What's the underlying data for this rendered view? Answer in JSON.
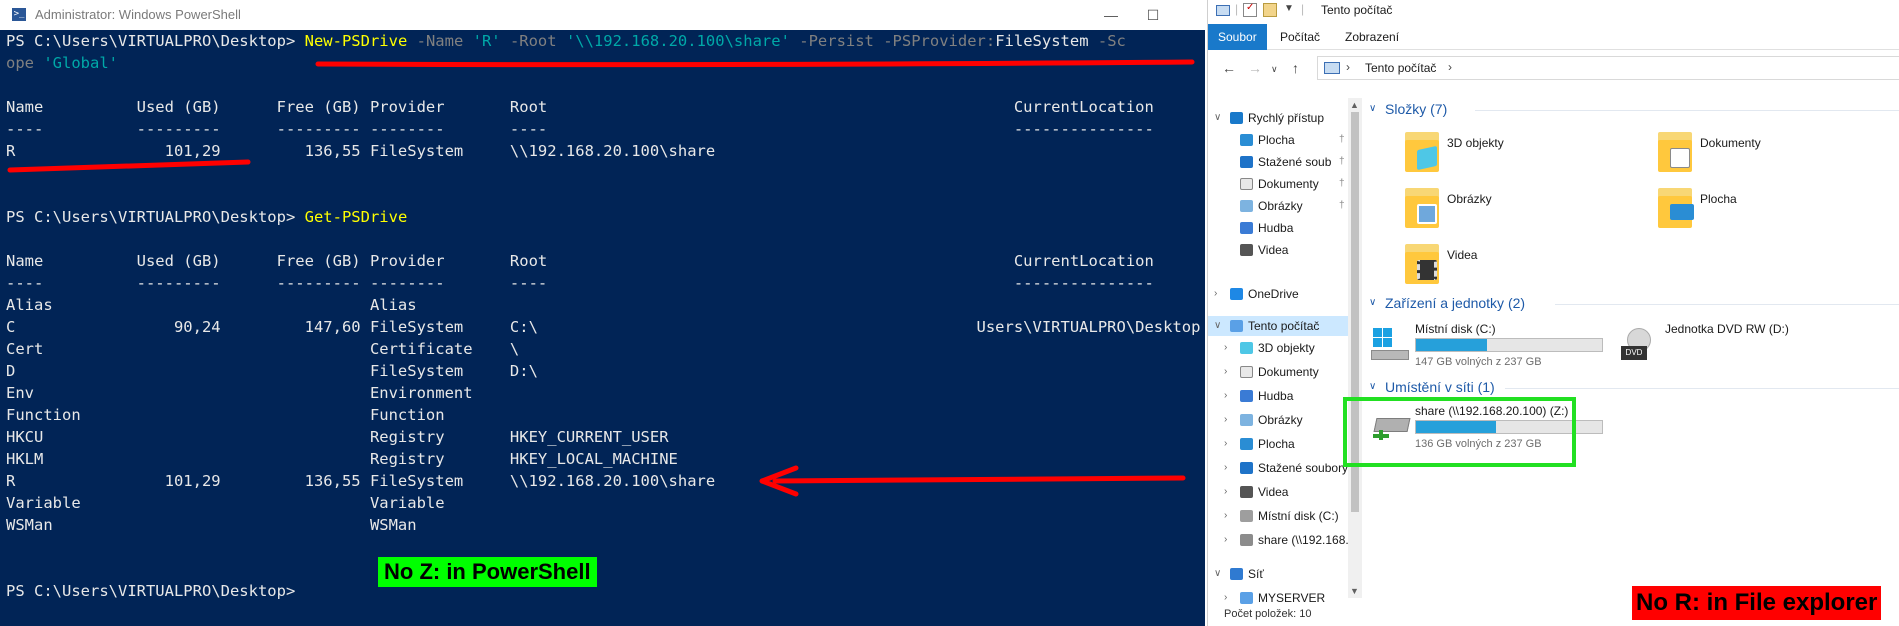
{
  "powershell": {
    "window_title": "Administrator: Windows PowerShell",
    "prompt": "PS C:\\Users\\VIRTUALPRO\\Desktop>",
    "command1": {
      "cmdlet": "New-PSDrive",
      "p_name": "-Name",
      "v_name": "'R'",
      "p_root": "-Root",
      "v_root": "'\\\\192.168.20.100\\share'",
      "p_persist": "-Persist",
      "p_provider": "-PSProvider:",
      "v_provider": "FileSystem",
      "p_scope_a": "-Sc",
      "p_scope_b": "ope",
      "v_scope": "'Global'"
    },
    "headers": {
      "name": "Name",
      "used": "Used (GB)",
      "free": "Free (GB)",
      "provider": "Provider",
      "root": "Root",
      "location": "CurrentLocation"
    },
    "dashes": {
      "name": "----",
      "used": "---------",
      "free": "---------",
      "provider": "--------",
      "root": "----",
      "location": "---------------"
    },
    "new_drive_row": {
      "name": "R",
      "used": "101,29",
      "free": "136,55",
      "provider": "FileSystem",
      "root": "\\\\192.168.20.100\\share",
      "location": ""
    },
    "command2": "Get-PSDrive",
    "drives": [
      {
        "name": "Alias",
        "used": "",
        "free": "",
        "provider": "Alias",
        "root": "",
        "location": ""
      },
      {
        "name": "C",
        "used": "90,24",
        "free": "147,60",
        "provider": "FileSystem",
        "root": "C:\\",
        "location": "Users\\VIRTUALPRO\\Desktop"
      },
      {
        "name": "Cert",
        "used": "",
        "free": "",
        "provider": "Certificate",
        "root": "\\",
        "location": ""
      },
      {
        "name": "D",
        "used": "",
        "free": "",
        "provider": "FileSystem",
        "root": "D:\\",
        "location": ""
      },
      {
        "name": "Env",
        "used": "",
        "free": "",
        "provider": "Environment",
        "root": "",
        "location": ""
      },
      {
        "name": "Function",
        "used": "",
        "free": "",
        "provider": "Function",
        "root": "",
        "location": ""
      },
      {
        "name": "HKCU",
        "used": "",
        "free": "",
        "provider": "Registry",
        "root": "HKEY_CURRENT_USER",
        "location": ""
      },
      {
        "name": "HKLM",
        "used": "",
        "free": "",
        "provider": "Registry",
        "root": "HKEY_LOCAL_MACHINE",
        "location": ""
      },
      {
        "name": "R",
        "used": "101,29",
        "free": "136,55",
        "provider": "FileSystem",
        "root": "\\\\192.168.20.100\\share",
        "location": ""
      },
      {
        "name": "Variable",
        "used": "",
        "free": "",
        "provider": "Variable",
        "root": "",
        "location": ""
      },
      {
        "name": "WSMan",
        "used": "",
        "free": "",
        "provider": "WSMan",
        "root": "",
        "location": ""
      }
    ],
    "annotation": "No Z: in PowerShell",
    "colors": {
      "background": "#012456",
      "command": "#ffff00",
      "string": "#00a8a8",
      "parameter": "#808080",
      "annotation": "#00ff00",
      "marker": "#ff0000"
    }
  },
  "explorer": {
    "window_title": "Tento počítač",
    "ribbon_tabs": [
      "Soubor",
      "Počítač",
      "Zobrazení"
    ],
    "address_crumb": "Tento počítač",
    "nav_items": [
      {
        "label": "Rychlý přístup",
        "icon": "star-icon"
      },
      {
        "label": "Plocha",
        "icon": "desktop-icon",
        "pinned": true
      },
      {
        "label": "Stažené soub",
        "icon": "download-icon",
        "pinned": true
      },
      {
        "label": "Dokumenty",
        "icon": "document-icon",
        "pinned": true
      },
      {
        "label": "Obrázky",
        "icon": "picture-icon",
        "pinned": true
      },
      {
        "label": "Hudba",
        "icon": "music-icon"
      },
      {
        "label": "Videa",
        "icon": "video-icon"
      },
      {
        "label": "OneDrive",
        "icon": "cloud-icon"
      },
      {
        "label": "Tento počítač",
        "icon": "computer-icon"
      },
      {
        "label": "3D objekty",
        "icon": "cube-icon"
      },
      {
        "label": "Dokumenty",
        "icon": "document-icon"
      },
      {
        "label": "Hudba",
        "icon": "music-icon"
      },
      {
        "label": "Obrázky",
        "icon": "picture-icon"
      },
      {
        "label": "Plocha",
        "icon": "desktop-icon"
      },
      {
        "label": "Stažené soubory",
        "icon": "download-icon"
      },
      {
        "label": "Videa",
        "icon": "video-icon"
      },
      {
        "label": "Místní disk (C:)",
        "icon": "disk-icon"
      },
      {
        "label": "share (\\\\192.168.",
        "icon": "network-drive-icon"
      },
      {
        "label": "Síť",
        "icon": "network-icon"
      },
      {
        "label": "MYSERVER",
        "icon": "computer-icon"
      }
    ],
    "groups": {
      "folders": "Složky (7)",
      "devices": "Zařízení a jednotky (2)",
      "network": "Umístění v síti (1)"
    },
    "folders": [
      "3D objekty",
      "Dokumenty",
      "Obrázky",
      "Plocha",
      "Videa"
    ],
    "drive_c": {
      "name": "Místní disk (C:)",
      "free_text": "147 GB volných z 237 GB",
      "used_fraction": 0.38
    },
    "drive_d": {
      "name": "Jednotka DVD RW (D:)",
      "badge": "DVD"
    },
    "drive_z": {
      "name": "share (\\\\192.168.20.100) (Z:)",
      "free_text": "136 GB volných z 237 GB",
      "used_fraction": 0.43
    },
    "status": "Počet položek: 10",
    "annotation": "No R: in File explorer",
    "colors": {
      "selection": "#cce8ff",
      "accent": "#1979ca",
      "group_title": "#1e5aa8",
      "bar_fill": "#26a0da",
      "highlight_box": "#22e022",
      "annotation": "#ff0000"
    }
  }
}
